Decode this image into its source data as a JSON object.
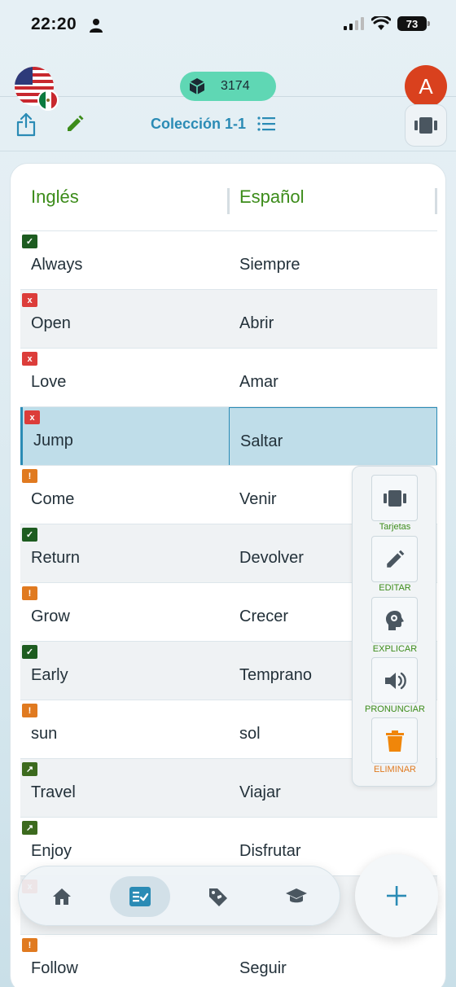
{
  "status_bar": {
    "time": "22:20",
    "battery": "73"
  },
  "header": {
    "coins": "3174",
    "avatar_letter": "A",
    "collection_title": "Colección 1-1"
  },
  "table": {
    "headers": {
      "english": "Inglés",
      "spanish": "Español"
    },
    "rows": [
      {
        "status": "ok",
        "badge": "✓",
        "en": "Always",
        "es": "Siempre"
      },
      {
        "status": "x",
        "badge": "x",
        "en": "Open",
        "es": "Abrir"
      },
      {
        "status": "x",
        "badge": "x",
        "en": "Love",
        "es": "Amar"
      },
      {
        "status": "x",
        "badge": "x",
        "en": "Jump",
        "es": "Saltar",
        "selected": true
      },
      {
        "status": "warn",
        "badge": "!",
        "en": "Come",
        "es": "Venir"
      },
      {
        "status": "ok",
        "badge": "✓",
        "en": "Return",
        "es": "Devolver"
      },
      {
        "status": "warn",
        "badge": "!",
        "en": "Grow",
        "es": "Crecer"
      },
      {
        "status": "ok",
        "badge": "✓",
        "en": "Early",
        "es": "Temprano"
      },
      {
        "status": "warn",
        "badge": "!",
        "en": "sun",
        "es": "sol"
      },
      {
        "status": "up",
        "badge": "↗",
        "en": "Travel",
        "es": "Viajar"
      },
      {
        "status": "up",
        "badge": "↗",
        "en": "Enjoy",
        "es": "Disfrutar"
      },
      {
        "status": "x",
        "badge": "x",
        "en": "",
        "es": ""
      },
      {
        "status": "warn",
        "badge": "!",
        "en": "Follow",
        "es": "Seguir"
      }
    ]
  },
  "context_menu": {
    "items": [
      {
        "label": "Tarjetas",
        "color": "#3c8c1a"
      },
      {
        "label": "EDITAR",
        "color": "#3c8c1a"
      },
      {
        "label": "EXPLICAR",
        "color": "#3c8c1a"
      },
      {
        "label": "PRONUNCIAR",
        "color": "#3c8c1a"
      },
      {
        "label": "ELIMINAR",
        "color": "#e07a20"
      }
    ]
  },
  "colors": {
    "accent_blue": "#2a8bb5",
    "accent_green": "#3c8c1a",
    "coins_pill": "#5fd7b4",
    "avatar": "#d9411e",
    "warn_orange": "#e07a20",
    "error_red": "#dc3d3a"
  },
  "bottom_nav": {
    "items": [
      {
        "icon": "home-icon"
      },
      {
        "icon": "checklist-icon",
        "active": true
      },
      {
        "icon": "tags-icon"
      },
      {
        "icon": "graduation-cap-icon"
      }
    ],
    "fab_icon": "plus-icon"
  }
}
